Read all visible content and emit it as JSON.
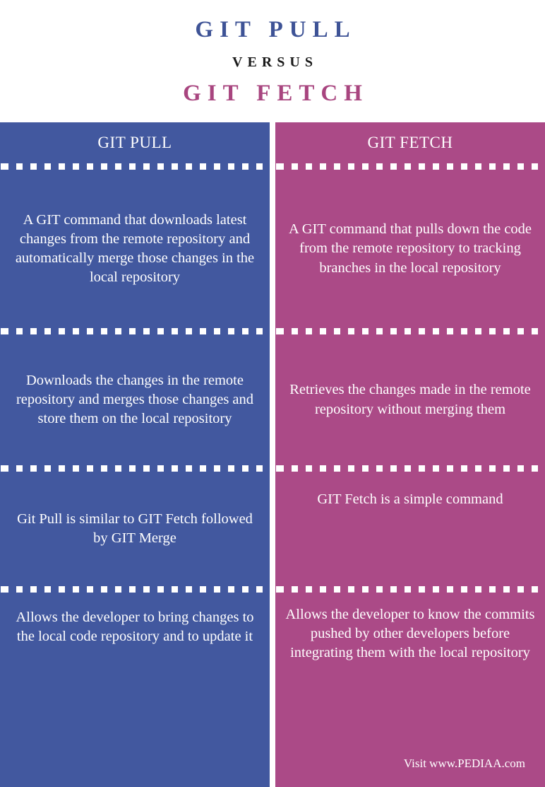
{
  "header": {
    "title_main": "GIT PULL",
    "versus": "VERSUS",
    "title_sub": "GIT FETCH",
    "color_main": "#3e5396",
    "color_sub": "#a8457f"
  },
  "colors": {
    "left_panel": "#42589f",
    "right_panel": "#ab4a87",
    "separator": "#ffffff",
    "text": "#ffffff"
  },
  "columns": [
    {
      "heading": "GIT PULL",
      "cells": [
        "A GIT command that downloads latest changes from the remote repository and automatically merge those changes in the local repository",
        "Downloads the changes in the remote repository and merges those changes and store them on the local repository",
        "Git Pull is similar to GIT Fetch followed by GIT Merge",
        "Allows the developer to bring changes to the local code repository and to update it"
      ]
    },
    {
      "heading": "GIT FETCH",
      "cells": [
        "A GIT command that pulls down the code from the remote repository to tracking branches in the local repository",
        "Retrieves the changes made in the remote repository without merging them",
        "GIT Fetch is a simple command",
        "Allows the developer to know the commits pushed by other developers before integrating them with the local repository"
      ]
    }
  ],
  "footer": {
    "attribution": "Visit www.PEDIAA.com"
  }
}
